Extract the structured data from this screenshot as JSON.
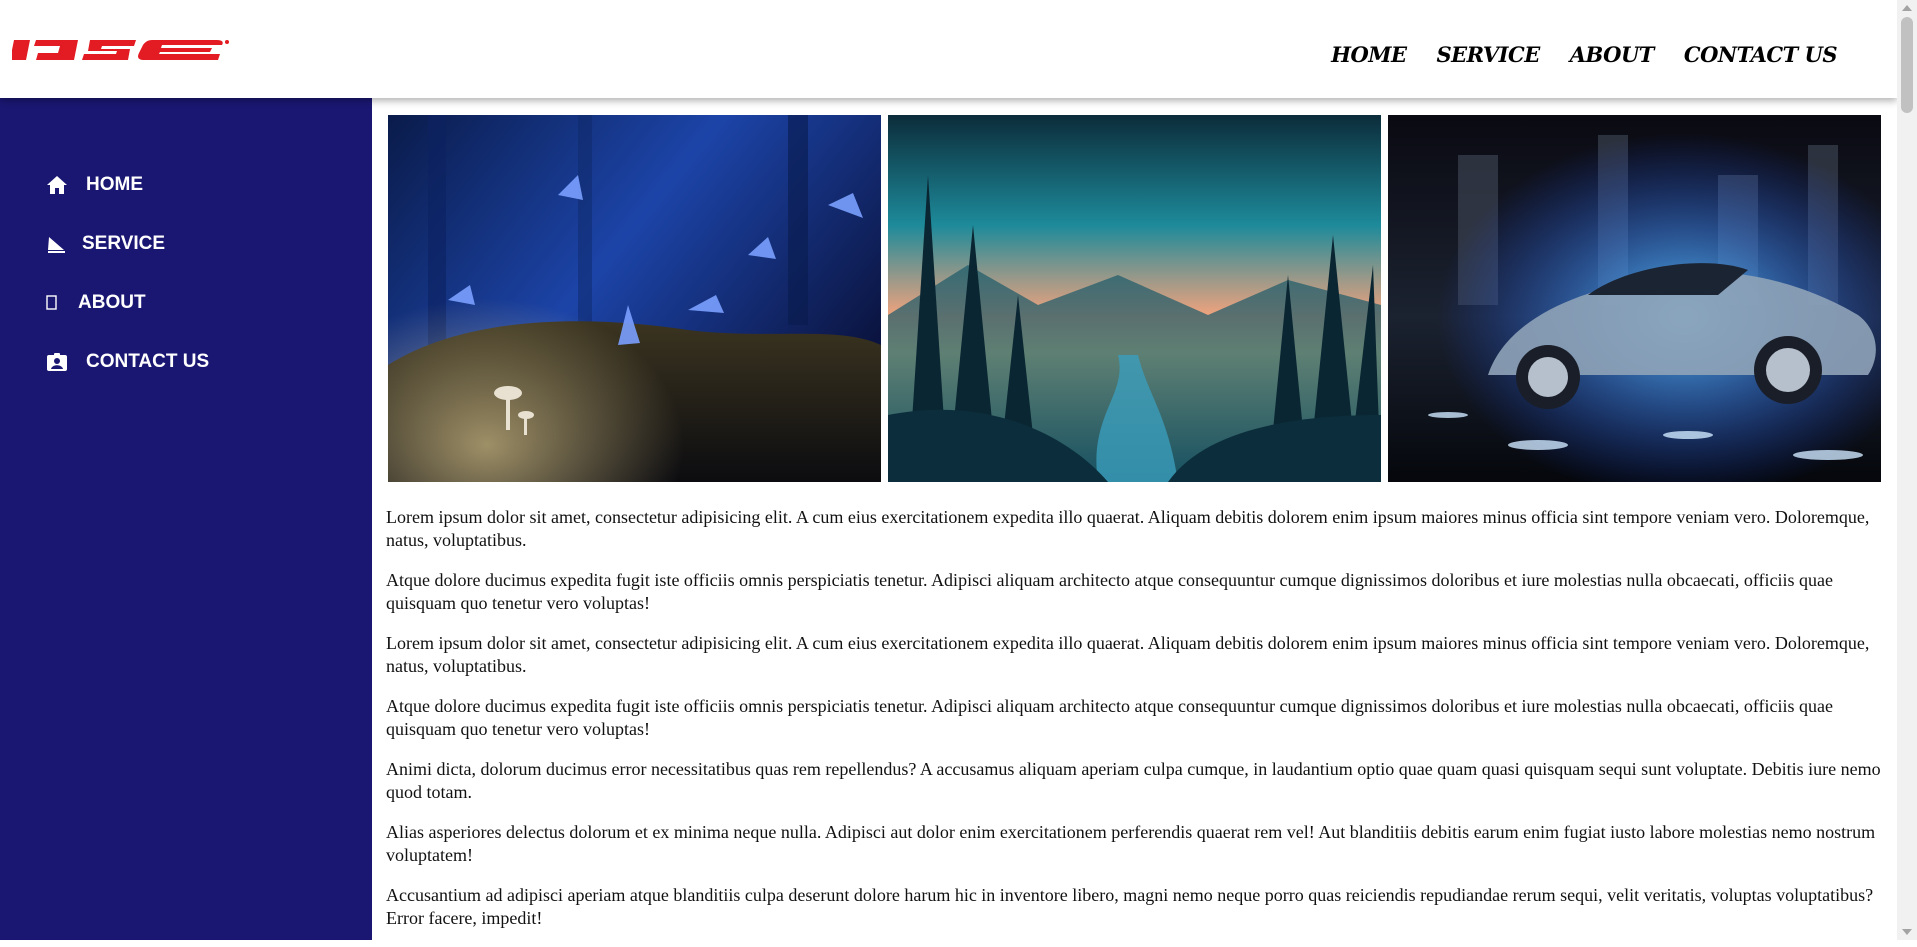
{
  "brand": {
    "logo_text": "IJSE",
    "logo_color": "#e31b23"
  },
  "topnav": {
    "items": [
      {
        "label": "HOME"
      },
      {
        "label": "SERVICE"
      },
      {
        "label": "ABOUT"
      },
      {
        "label": "CONTACT US"
      }
    ]
  },
  "sidebar": {
    "background": "#1a1773",
    "items": [
      {
        "label": "HOME",
        "icon": "home-icon"
      },
      {
        "label": "SERVICE",
        "icon": "service-icon"
      },
      {
        "label": "ABOUT",
        "icon": "about-icon"
      },
      {
        "label": "CONTACT US",
        "icon": "contact-card-icon"
      }
    ]
  },
  "gallery": {
    "images": [
      {
        "subject": "butterflies-and-mushrooms-forest"
      },
      {
        "subject": "forest-river-sunset"
      },
      {
        "subject": "sports-car-water-splash"
      }
    ]
  },
  "content": {
    "paragraphs": [
      "Lorem ipsum dolor sit amet, consectetur adipisicing elit. A cum eius exercitationem expedita illo quaerat. Aliquam debitis dolorem enim ipsum maiores minus officia sint tempore veniam vero. Doloremque, natus, voluptatibus.",
      "Atque dolore ducimus expedita fugit iste officiis omnis perspiciatis tenetur. Adipisci aliquam architecto atque consequuntur cumque dignissimos doloribus et iure molestias nulla obcaecati, officiis quae quisquam quo tenetur vero voluptas!",
      "Lorem ipsum dolor sit amet, consectetur adipisicing elit. A cum eius exercitationem expedita illo quaerat. Aliquam debitis dolorem enim ipsum maiores minus officia sint tempore veniam vero. Doloremque, natus, voluptatibus.",
      "Atque dolore ducimus expedita fugit iste officiis omnis perspiciatis tenetur. Adipisci aliquam architecto atque consequuntur cumque dignissimos doloribus et iure molestias nulla obcaecati, officiis quae quisquam quo tenetur vero voluptas!",
      "Animi dicta, dolorum ducimus error necessitatibus quas rem repellendus? A accusamus aliquam aperiam culpa cumque, in laudantium optio quae quam quasi quisquam sequi sunt voluptate. Debitis iure nemo quod totam.",
      "Alias asperiores delectus dolorum et ex minima neque nulla. Adipisci aut dolor enim exercitationem perferendis quaerat rem vel! Aut blanditiis debitis earum enim fugiat iusto labore molestias nemo nostrum voluptatem!",
      "Accusantium ad adipisci aperiam atque blanditiis culpa deserunt dolore harum hic in inventore libero, magni nemo neque porro quas reiciendis repudiandae rerum sequi, velit veritatis, voluptas voluptatibus? Error facere, impedit!"
    ]
  }
}
